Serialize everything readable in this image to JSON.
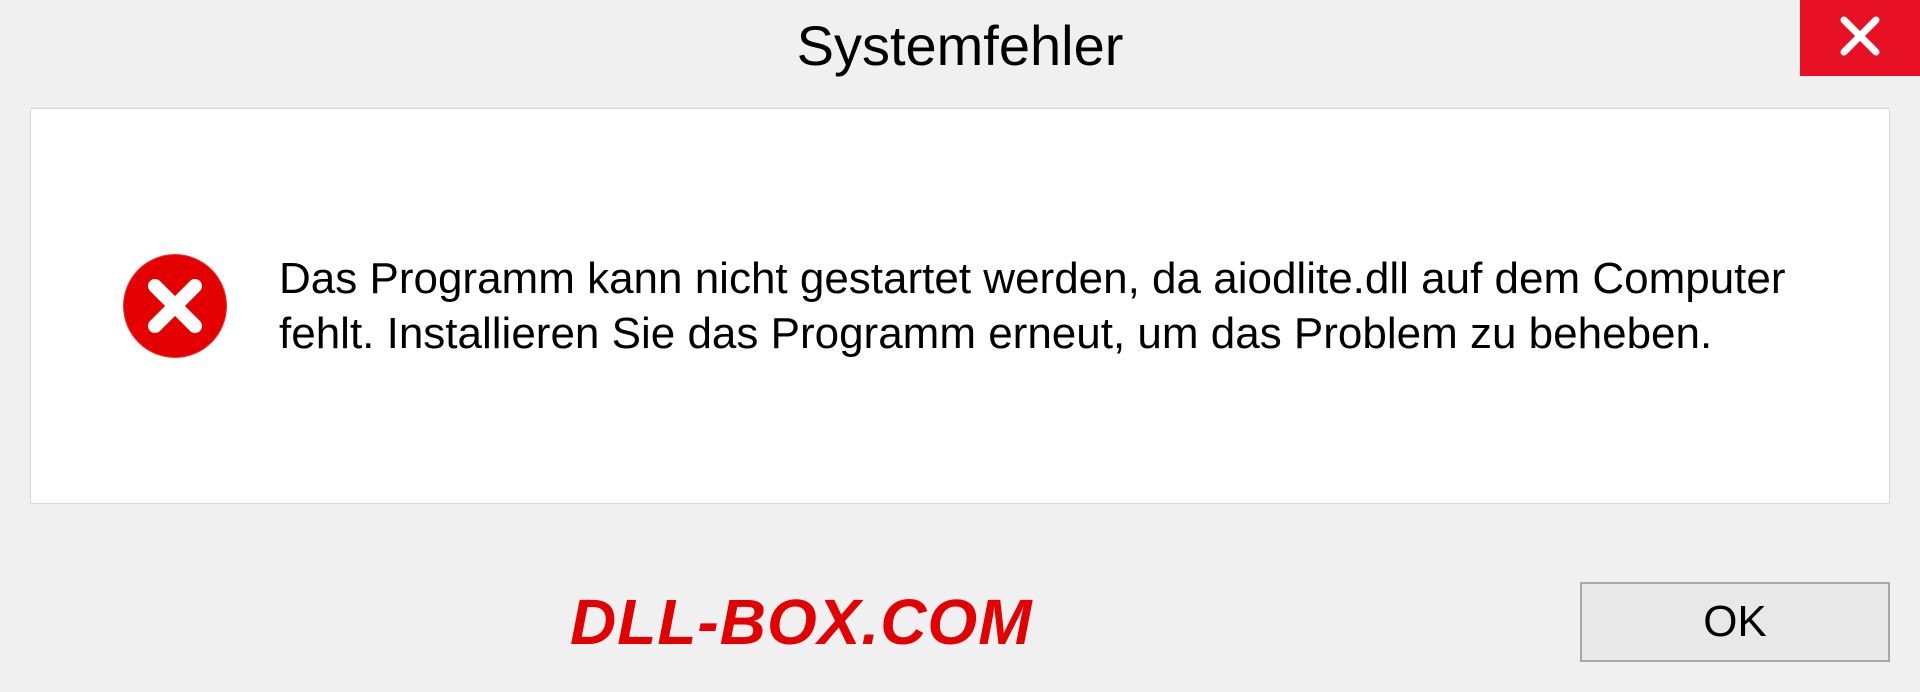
{
  "dialog": {
    "title": "Systemfehler",
    "message": "Das Programm kann nicht gestartet werden, da aiodlite.dll auf dem Computer fehlt. Installieren Sie das Programm erneut, um das Problem zu beheben.",
    "ok_label": "OK"
  },
  "watermark": "DLL-BOX.COM"
}
